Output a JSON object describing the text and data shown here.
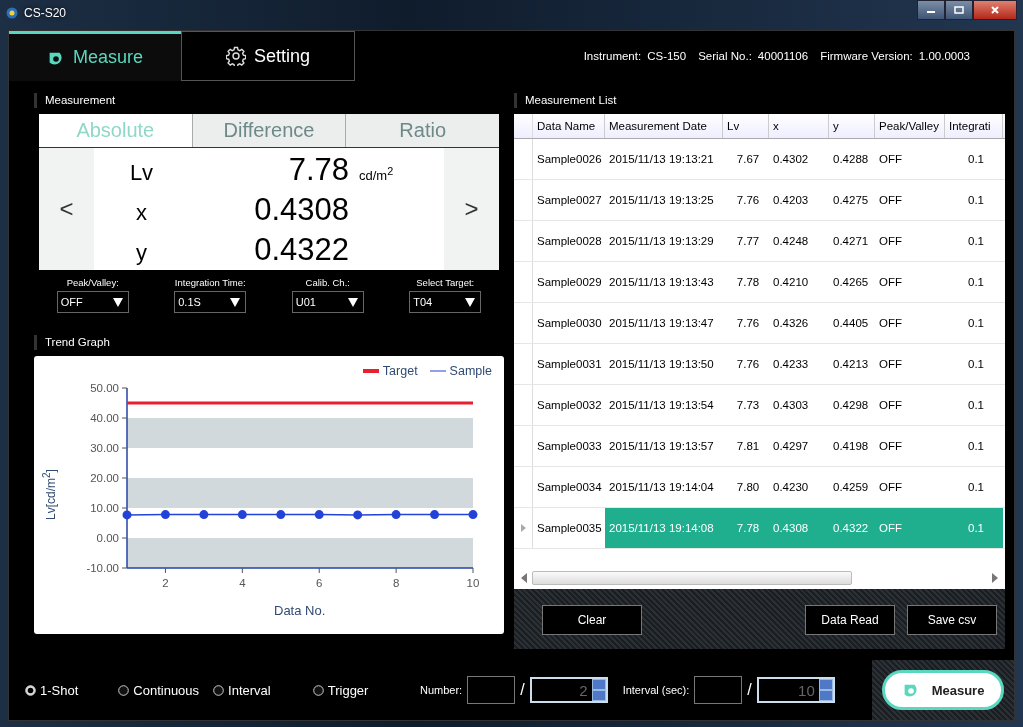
{
  "window": {
    "title": "CS-S20"
  },
  "tabs": [
    {
      "label": "Measure",
      "selected": true
    },
    {
      "label": "Setting",
      "selected": false
    }
  ],
  "instrument_info": [
    {
      "label": "Instrument:",
      "value": "CS-150"
    },
    {
      "label": "Serial No.:",
      "value": "40001106"
    },
    {
      "label": "Firmware Version:",
      "value": "1.00.0003"
    }
  ],
  "measurement": {
    "title": "Measurement",
    "modes": [
      {
        "label": "Absolute",
        "selected": true
      },
      {
        "label": "Difference",
        "selected": false
      },
      {
        "label": "Ratio",
        "selected": false
      }
    ],
    "prev": "<",
    "next": ">",
    "values": [
      {
        "name": "Lv",
        "value": "7.78",
        "unit": "cd/m$^{2}$"
      },
      {
        "name": "x",
        "value": "0.4308"
      },
      {
        "name": "y",
        "value": "0.4322"
      }
    ],
    "settings": [
      {
        "label": "Peak/Valley:",
        "value": "OFF"
      },
      {
        "label": "Integration Time:",
        "value": "0.1S"
      },
      {
        "label": "Calib. Ch.:",
        "value": "U01"
      },
      {
        "label": "Select Target:",
        "value": "T04"
      }
    ]
  },
  "trend_graph": {
    "title": "Trend Graph",
    "chart_data": {
      "type": "line",
      "xlabel": "Data No.",
      "ylabel": "Lv[cd/m$^{2}$]",
      "x": [
        1,
        2,
        3,
        4,
        5,
        6,
        7,
        8,
        9,
        10
      ],
      "series": [
        {
          "name": "Target",
          "color": "#e8202e",
          "values": [
            45,
            45,
            45,
            45,
            45,
            45,
            45,
            45,
            45,
            45
          ]
        },
        {
          "name": "Sample",
          "color": "#2343d8",
          "marker": "circle",
          "values": [
            7.7,
            7.8,
            7.8,
            7.8,
            7.8,
            7.8,
            7.7,
            7.8,
            7.8,
            7.8
          ]
        }
      ],
      "legend": "upper right",
      "xlim": [
        1,
        10
      ],
      "ylim": [
        -10,
        50
      ],
      "xticks": [
        2,
        4,
        6,
        8,
        10
      ],
      "yticks": [
        {
          "value": 50,
          "label": "50.00"
        },
        {
          "value": 40,
          "label": "40.00"
        },
        {
          "value": 30,
          "label": "30.00"
        },
        {
          "value": 20,
          "label": "20.00"
        },
        {
          "value": 10,
          "label": "10.00"
        },
        {
          "value": 0,
          "label": "0.00"
        },
        {
          "value": -10,
          "label": "-10.00"
        }
      ]
    }
  },
  "measurement_list": {
    "title": "Measurement List",
    "columns": [
      "Data Name",
      "Measurement Date",
      "Lv",
      "x",
      "y",
      "Peak/Valley",
      "Integrati"
    ],
    "rows": [
      {
        "cells": [
          "Sample0026",
          "2015/11/13 19:13:21",
          "7.67",
          "0.4302",
          "0.4288",
          "OFF",
          "0.1"
        ],
        "selected": false
      },
      {
        "cells": [
          "Sample0027",
          "2015/11/13 19:13:25",
          "7.76",
          "0.4203",
          "0.4275",
          "OFF",
          "0.1"
        ],
        "selected": false
      },
      {
        "cells": [
          "Sample0028",
          "2015/11/13 19:13:29",
          "7.77",
          "0.4248",
          "0.4271",
          "OFF",
          "0.1"
        ],
        "selected": false
      },
      {
        "cells": [
          "Sample0029",
          "2015/11/13 19:13:43",
          "7.78",
          "0.4210",
          "0.4265",
          "OFF",
          "0.1"
        ],
        "selected": false
      },
      {
        "cells": [
          "Sample0030",
          "2015/11/13 19:13:47",
          "7.76",
          "0.4326",
          "0.4405",
          "OFF",
          "0.1"
        ],
        "selected": false
      },
      {
        "cells": [
          "Sample0031",
          "2015/11/13 19:13:50",
          "7.76",
          "0.4233",
          "0.4213",
          "OFF",
          "0.1"
        ],
        "selected": false
      },
      {
        "cells": [
          "Sample0032",
          "2015/11/13 19:13:54",
          "7.73",
          "0.4303",
          "0.4298",
          "OFF",
          "0.1"
        ],
        "selected": false
      },
      {
        "cells": [
          "Sample0033",
          "2015/11/13 19:13:57",
          "7.81",
          "0.4297",
          "0.4198",
          "OFF",
          "0.1"
        ],
        "selected": false
      },
      {
        "cells": [
          "Sample0034",
          "2015/11/13 19:14:04",
          "7.80",
          "0.4230",
          "0.4259",
          "OFF",
          "0.1"
        ],
        "selected": false
      },
      {
        "cells": [
          "Sample0035",
          "2015/11/13 19:14:08",
          "7.78",
          "0.4308",
          "0.4322",
          "OFF",
          "0.1"
        ],
        "selected": true
      }
    ],
    "buttons": [
      "Clear",
      "Data Read",
      "Save csv"
    ]
  },
  "modes": [
    {
      "label": "1-Shot",
      "selected": true
    },
    {
      "label": "Continuous",
      "selected": false
    },
    {
      "label": "Interval",
      "selected": false
    },
    {
      "label": "Trigger",
      "selected": false
    }
  ],
  "number": {
    "label": "Number:",
    "separator": "/",
    "total": "2"
  },
  "interval": {
    "label": "Interval (sec):",
    "separator": "/",
    "total": "10"
  },
  "measure_button": "Measure"
}
